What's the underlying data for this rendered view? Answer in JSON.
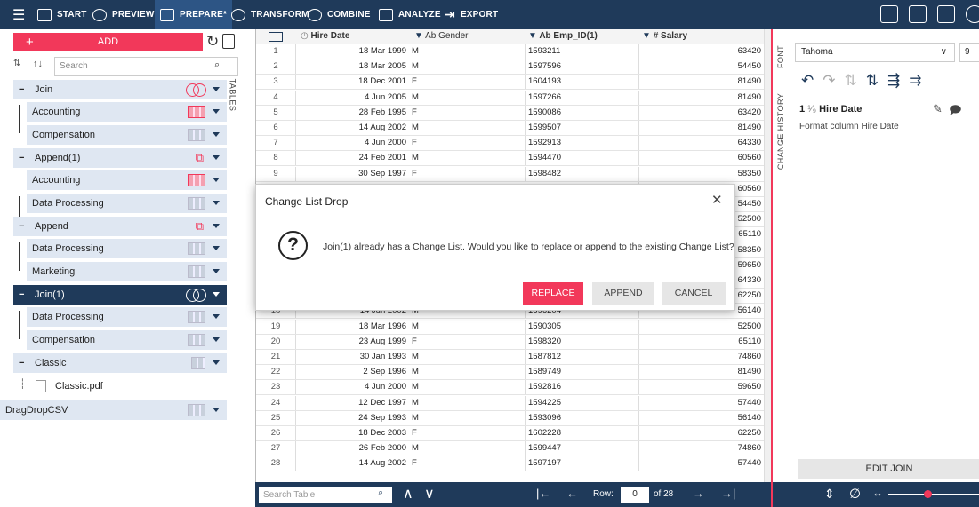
{
  "toolbar": {
    "items": [
      {
        "label": "START"
      },
      {
        "label": "PREVIEW"
      },
      {
        "label": "PREPARE*"
      },
      {
        "label": "TRANSFORM"
      },
      {
        "label": "COMBINE"
      },
      {
        "label": "ANALYZE"
      },
      {
        "label": "EXPORT"
      }
    ]
  },
  "left": {
    "add_label": "ADD",
    "search_placeholder": "Search",
    "tables_tab": "TABLES",
    "tree": [
      {
        "label": "Join",
        "collapse": "−"
      },
      {
        "label": "Accounting"
      },
      {
        "label": "Compensation"
      },
      {
        "label": "Append(1)",
        "collapse": "−"
      },
      {
        "label": "Accounting"
      },
      {
        "label": "Data Processing"
      },
      {
        "label": "Append",
        "collapse": "−"
      },
      {
        "label": "Data Processing"
      },
      {
        "label": "Marketing"
      },
      {
        "label": "Join(1)",
        "collapse": "−"
      },
      {
        "label": "Data Processing"
      },
      {
        "label": "Compensation"
      },
      {
        "label": "Classic",
        "collapse": "−"
      },
      {
        "label": "Classic.pdf"
      },
      {
        "label": "DragDropCSV"
      }
    ]
  },
  "grid": {
    "headers": [
      "Hire Date",
      "Ab Gender",
      "Ab Emp_ID(1)",
      "# Salary"
    ],
    "rows": [
      [
        "1",
        "18 Mar 1999",
        "M",
        "1593211",
        "63420"
      ],
      [
        "2",
        "18 Mar 2005",
        "M",
        "1597596",
        "54450"
      ],
      [
        "3",
        "18 Dec 2001",
        "F",
        "1604193",
        "81490"
      ],
      [
        "4",
        "4 Jun 2005",
        "M",
        "1597266",
        "81490"
      ],
      [
        "5",
        "28 Feb 1995",
        "F",
        "1590086",
        "63420"
      ],
      [
        "6",
        "14 Aug 2002",
        "M",
        "1599507",
        "81490"
      ],
      [
        "7",
        "4 Jun 2000",
        "F",
        "1592913",
        "64330"
      ],
      [
        "8",
        "24 Feb 2001",
        "M",
        "1594470",
        "60560"
      ],
      [
        "9",
        "30 Sep 1997",
        "F",
        "1598482",
        "58350"
      ],
      [
        "",
        "",
        "",
        "",
        "60560"
      ],
      [
        "",
        "",
        "",
        "",
        "54450"
      ],
      [
        "",
        "",
        "",
        "",
        "52500"
      ],
      [
        "",
        "",
        "",
        "",
        "65110"
      ],
      [
        "",
        "",
        "",
        "",
        "58350"
      ],
      [
        "",
        "",
        "",
        "",
        "59650"
      ],
      [
        "",
        "",
        "",
        "",
        "64330"
      ],
      [
        "",
        "",
        "",
        "",
        "62250"
      ],
      [
        "18",
        "14 Jun 2002",
        "M",
        "1596204",
        "56140"
      ],
      [
        "19",
        "18 Mar 1996",
        "M",
        "1590305",
        "52500"
      ],
      [
        "20",
        "23 Aug 1999",
        "F",
        "1598320",
        "65110"
      ],
      [
        "21",
        "30 Jan 1993",
        "M",
        "1587812",
        "74860"
      ],
      [
        "22",
        "2 Sep 1996",
        "M",
        "1589749",
        "81490"
      ],
      [
        "23",
        "4 Jun 2000",
        "M",
        "1592816",
        "59650"
      ],
      [
        "24",
        "12 Dec 1997",
        "M",
        "1594225",
        "57440"
      ],
      [
        "25",
        "24 Sep 1993",
        "M",
        "1593096",
        "56140"
      ],
      [
        "26",
        "18 Dec 2003",
        "F",
        "1602228",
        "62250"
      ],
      [
        "27",
        "26 Feb 2000",
        "M",
        "1599447",
        "74860"
      ],
      [
        "28",
        "14 Aug 2002",
        "F",
        "1597197",
        "57440"
      ]
    ]
  },
  "bottom": {
    "search_placeholder": "Search Table",
    "row_label": "Row:",
    "row_value": "0",
    "of_label": "of 28"
  },
  "right": {
    "font_tab": "FONT",
    "history_tab": "CHANGE HISTORY",
    "font_name": "Tahoma",
    "font_size": "9",
    "history_index": "1",
    "history_title": "Hire Date",
    "history_desc": "Format column Hire Date",
    "edit_join": "EDIT JOIN"
  },
  "dialog": {
    "title": "Change List Drop",
    "message": "Join(1) already has a Change List. Would you like to replace or append to the existing Change List?",
    "replace": "REPLACE",
    "append": "APPEND",
    "cancel": "CANCEL"
  },
  "colors": {
    "accent": "#f2385a",
    "navy": "#1f3a5a"
  }
}
